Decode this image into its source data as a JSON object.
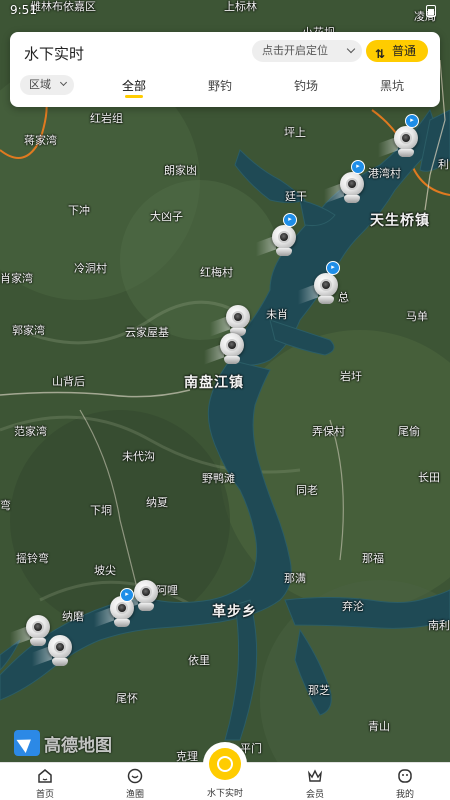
{
  "status": {
    "time": "9:51"
  },
  "header": {
    "title": "水下实时",
    "locate_label": "点击开启定位",
    "mode_label": "普通",
    "region_label": "区域",
    "tabs": [
      "全部",
      "野钓",
      "钓场",
      "黑坑"
    ],
    "active_tab": "全部"
  },
  "map": {
    "logo_text": "高德地图",
    "labels": {
      "top_left": "雌林布依嘉区",
      "top_mid": "上标林",
      "top_mid2": "小花坝",
      "top_right": "凌局",
      "hongyan": "红岩组",
      "jiangjiawan": "蒋家湾",
      "pingshang": "坪上",
      "langjiaao": "朗家凼",
      "gangwancun": "港湾村",
      "li": "利",
      "tinggan": "廷干",
      "xiachong": "下冲",
      "daxiongzi": "大凶子",
      "tianshengqiao": "天生桥镇",
      "xiaojiawan": "肖家湾",
      "lengdong": "冷洞村",
      "hongluncun": "红梅村",
      "zong": "总",
      "madan": "马单",
      "guojiawan": "郭家湾",
      "yunjia": "云家屋基",
      "weixiao": "未肖",
      "shanbei": "山背后",
      "nanpanjiang": "南盘江镇",
      "yanhao": "岩圩",
      "fanjiawan": "范家湾",
      "nongbao": "弄保村",
      "weiyu": "尾偷",
      "weidaigou": "未代沟",
      "yeyatan": "野鸭滩",
      "changtian": "长田",
      "xiadong": "下垌",
      "nahou": "纳夏",
      "tonglao": "同老",
      "wan": "弯",
      "yaoling": "摇铃弯",
      "powei": "坡尖",
      "nafu": "那福",
      "ali": "阿哩",
      "namo": "那满",
      "nali": "纳磨",
      "gebuxiang": "革步乡",
      "yilun": "弃沦",
      "nanli": "南利",
      "yili": "依里",
      "nazhi": "那芝",
      "weihuai": "尾怀",
      "qingyan": "青山",
      "jingyu": "克理",
      "pingmen": "平门"
    }
  },
  "nav": {
    "items": [
      "首页",
      "渔圈",
      "水下实时",
      "会员",
      "我的"
    ],
    "active": "水下实时"
  },
  "colors": {
    "accent": "#ffcc00",
    "marker_bubble": "#1e8ee8",
    "water": "#1f4a55",
    "land": "#3a5233"
  }
}
